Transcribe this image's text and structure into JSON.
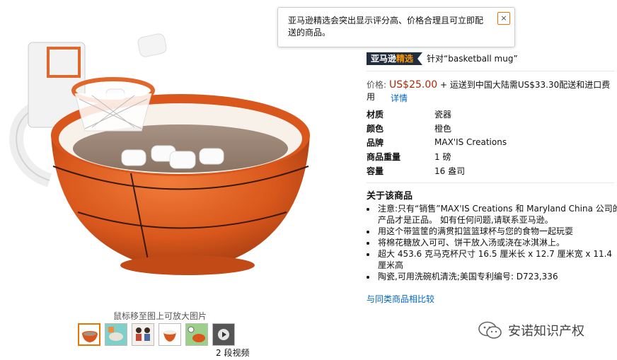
{
  "tooltip": {
    "text": "亚马逊精选会突出显示评分高、价格合理且可立即配送的商品。",
    "close_label": "×"
  },
  "badge": {
    "brand": "亚马逊",
    "accent": "精选",
    "keyword_text": "针对“basketball mug”"
  },
  "price": {
    "label": "价格:",
    "value": "US$25.00",
    "shipping": "+ 运送到中国大陆需US$33.30配送和进口费用",
    "details_link": "详情"
  },
  "specs": [
    {
      "key": "材质",
      "value": "瓷器"
    },
    {
      "key": "颜色",
      "value": "橙色"
    },
    {
      "key": "品牌",
      "value": "MAX'IS Creations"
    },
    {
      "key": "商品重量",
      "value": "1 磅"
    },
    {
      "key": "容量",
      "value": "16 盎司"
    }
  ],
  "about": {
    "title": "关于该商品",
    "bullets": [
      "注意:只有“销售”MAX'IS Creations 和 Maryland China 公司的产品才是正品。 如有任何问题,请联系亚马逊。",
      "用这个带篮筐的满贯扣篮篮球杯与您的食物一起玩耍",
      "将棉花糖放入可可、饼干放入汤或浇在冰淇淋上。",
      "超大 453.6 克马克杯尺寸 16.5 厘米长 x 12.7 厘米宽 x 11.4 厘米高",
      "陶瓷,可用洗碗机清洗;美国专利编号: D723,336"
    ],
    "compare_link": "与同类商品相比较"
  },
  "gallery": {
    "zoom_hint": "鼠标移至图上可放大图片",
    "video_count": "2 段视频"
  },
  "watermark": {
    "text": "安诺知识产权",
    "icon": "wechat-icon"
  },
  "colors": {
    "price": "#b12704",
    "link": "#0066c0",
    "badge_bg": "#232f3e",
    "badge_accent": "#ff9900",
    "selected_border": "#e77600",
    "mug_orange": "#d9571c"
  }
}
